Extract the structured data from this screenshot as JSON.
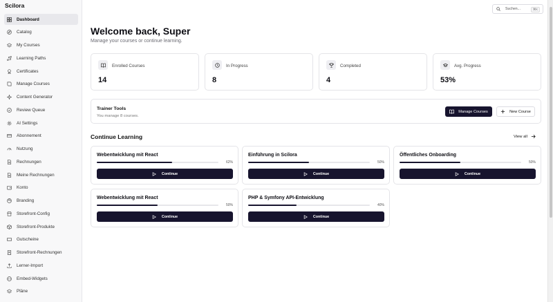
{
  "app": {
    "brand": "Scilora"
  },
  "sidebar": {
    "items": [
      {
        "label": "Dashboard",
        "icon": "grid-icon",
        "active": true
      },
      {
        "label": "Catalog",
        "icon": "compass-icon"
      },
      {
        "label": "My Courses",
        "icon": "layers-icon"
      },
      {
        "label": "Learning Paths",
        "icon": "route-icon"
      },
      {
        "label": "Certificates",
        "icon": "certificate-icon"
      },
      {
        "label": "Manage Courses",
        "icon": "book-icon"
      },
      {
        "label": "Content Generator",
        "icon": "sparkles-icon"
      },
      {
        "label": "Review Queue",
        "icon": "check-circle-icon"
      },
      {
        "label": "AI Settings",
        "icon": "gear-icon"
      },
      {
        "label": "Abonnement",
        "icon": "credit-card-icon"
      },
      {
        "label": "Nutzung",
        "icon": "gauge-icon"
      },
      {
        "label": "Rechnungen",
        "icon": "file-icon"
      },
      {
        "label": "Meine Rechnungen",
        "icon": "file-icon"
      },
      {
        "label": "Konto",
        "icon": "wallet-icon"
      },
      {
        "label": "Branding",
        "icon": "palette-icon"
      },
      {
        "label": "Storefront-Config",
        "icon": "store-icon"
      },
      {
        "label": "Storefront-Produkte",
        "icon": "package-icon"
      },
      {
        "label": "Gutscheine",
        "icon": "ticket-icon"
      },
      {
        "label": "Storefront-Rechnungen",
        "icon": "receipt-icon"
      },
      {
        "label": "Lerner-Import",
        "icon": "upload-icon"
      },
      {
        "label": "Embed-Widgets",
        "icon": "code-icon"
      },
      {
        "label": "Pläne",
        "icon": "layers-icon"
      }
    ]
  },
  "search": {
    "placeholder": "Suchen...",
    "shortcut": "⌘K"
  },
  "header": {
    "title": "Welcome back, Super",
    "subtitle": "Manage your courses or continue learning."
  },
  "stats": [
    {
      "label": "Enrolled Courses",
      "value": "14",
      "icon": "book-open-icon"
    },
    {
      "label": "In Progress",
      "value": "8",
      "icon": "clock-icon"
    },
    {
      "label": "Completed",
      "value": "4",
      "icon": "trophy-icon"
    },
    {
      "label": "Avg. Progress",
      "value": "53%",
      "icon": "cap-icon"
    }
  ],
  "trainer": {
    "title": "Trainer Tools",
    "subtitle": "You manage 8 courses.",
    "manage_label": "Manage Courses",
    "new_label": "New Course"
  },
  "continue_learning": {
    "title": "Continue Learning",
    "view_all": "View all",
    "button_label": "Continue",
    "courses": [
      {
        "title": "Webentwicklung mit React",
        "progress": 62,
        "progress_label": "62%"
      },
      {
        "title": "Einführung in Scilora",
        "progress": 50,
        "progress_label": "50%"
      },
      {
        "title": "Öffentliches Onboarding",
        "progress": 50,
        "progress_label": "50%"
      },
      {
        "title": "Webentwicklung mit React",
        "progress": 50,
        "progress_label": "50%"
      },
      {
        "title": "PHP & Symfony API-Entwicklung",
        "progress": 40,
        "progress_label": "40%"
      }
    ]
  },
  "colors": {
    "primary": "#17142e",
    "border": "#e4e4e8",
    "sidebar_bg": "#f8f8f9"
  }
}
